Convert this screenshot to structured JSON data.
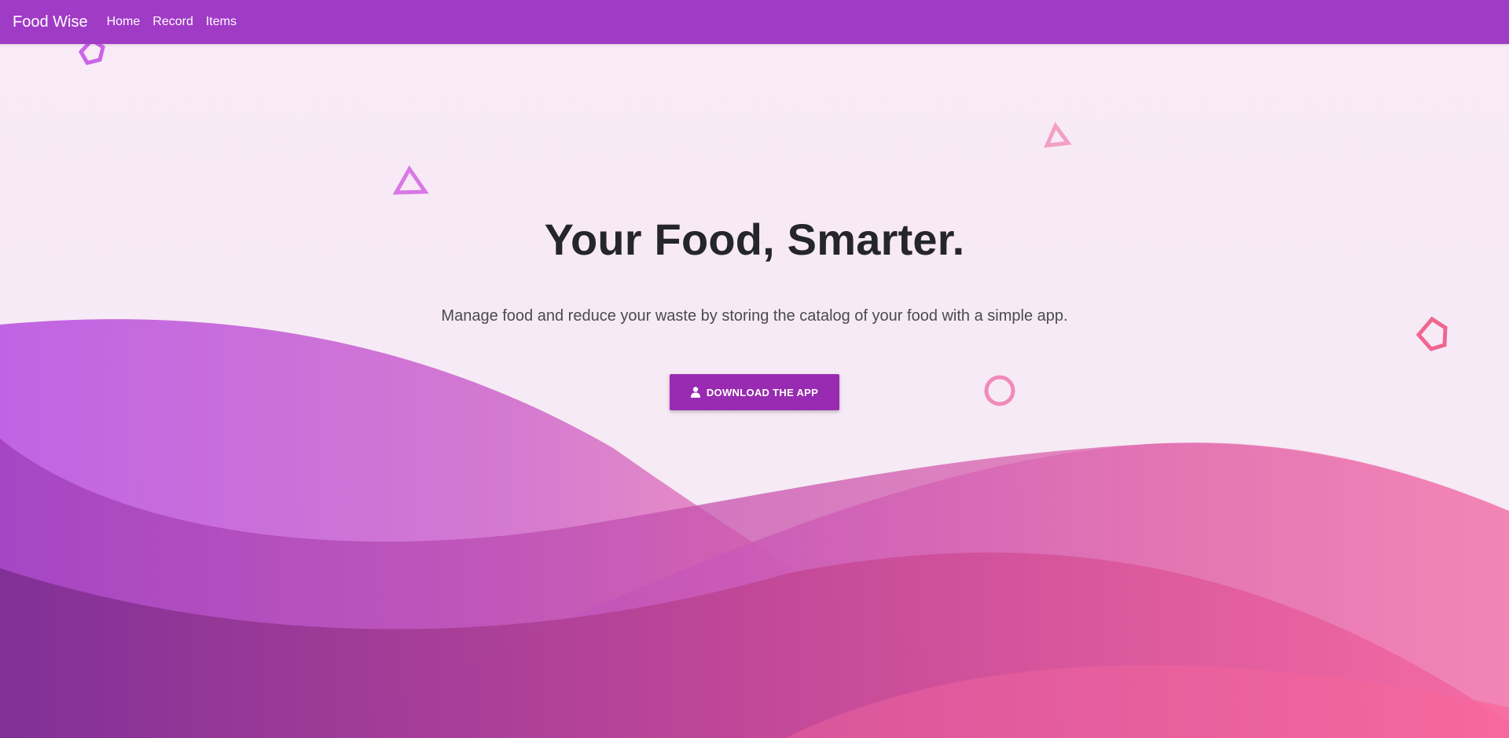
{
  "navbar": {
    "brand": "Food Wise",
    "links": [
      "Home",
      "Record",
      "Items"
    ],
    "color": "#a03bc6"
  },
  "hero": {
    "title": "Your Food, Smarter.",
    "subtitle": "Manage food and reduce your waste by storing the catalog of your food with a simple app.",
    "cta_label": "DOWNLOAD THE APP",
    "cta_icon": "user-icon",
    "cta_color": "#982bb1"
  },
  "decorations": {
    "shapes": [
      "pentagon-outline",
      "triangle-outline",
      "triangle-outline",
      "pentagon-outline",
      "circle-outline"
    ],
    "colors": {
      "purple": "#b85fe3",
      "pink": "#f06fa0",
      "deep_purple": "#7a2c8f"
    }
  }
}
